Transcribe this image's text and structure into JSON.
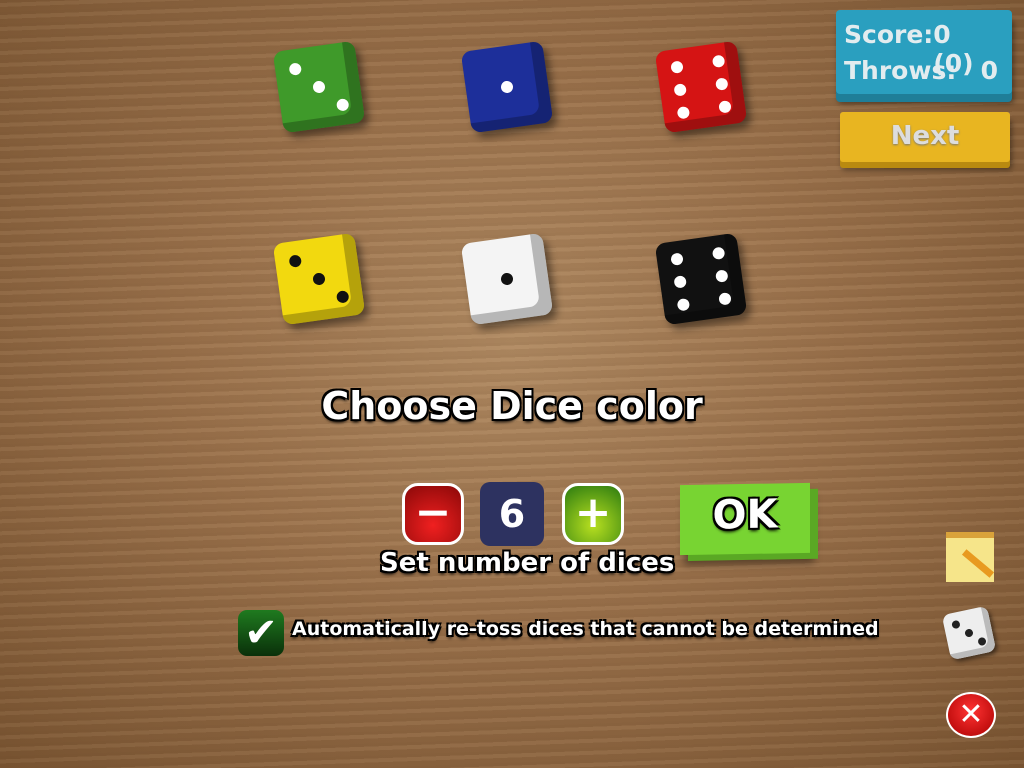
{
  "score": {
    "score_label": "Score:",
    "score_value": "0 (0)",
    "throws_label": "Throws:",
    "throws_value": "0"
  },
  "next_label": "Next",
  "dice": [
    {
      "color": "green",
      "hex": "#3f9a2a",
      "face": 3
    },
    {
      "color": "blue",
      "hex": "#1d2f9a",
      "face": 1
    },
    {
      "color": "red",
      "hex": "#d51414",
      "face": 6
    },
    {
      "color": "yellow",
      "hex": "#f2d90f",
      "face": 3
    },
    {
      "color": "white",
      "hex": "#f4f4f4",
      "face": 1
    },
    {
      "color": "black",
      "hex": "#111111",
      "face": 6
    }
  ],
  "title": "Choose Dice color",
  "stepper": {
    "minus": "−",
    "value": "6",
    "plus": "+",
    "label": "Set number of dices"
  },
  "ok_label": "OK",
  "auto_retoss": {
    "checked": true,
    "label": "Automatically re-toss dices that cannot be determined"
  },
  "side_icons": [
    "notepad-pencil-icon",
    "dice-icon",
    "close-icon"
  ]
}
